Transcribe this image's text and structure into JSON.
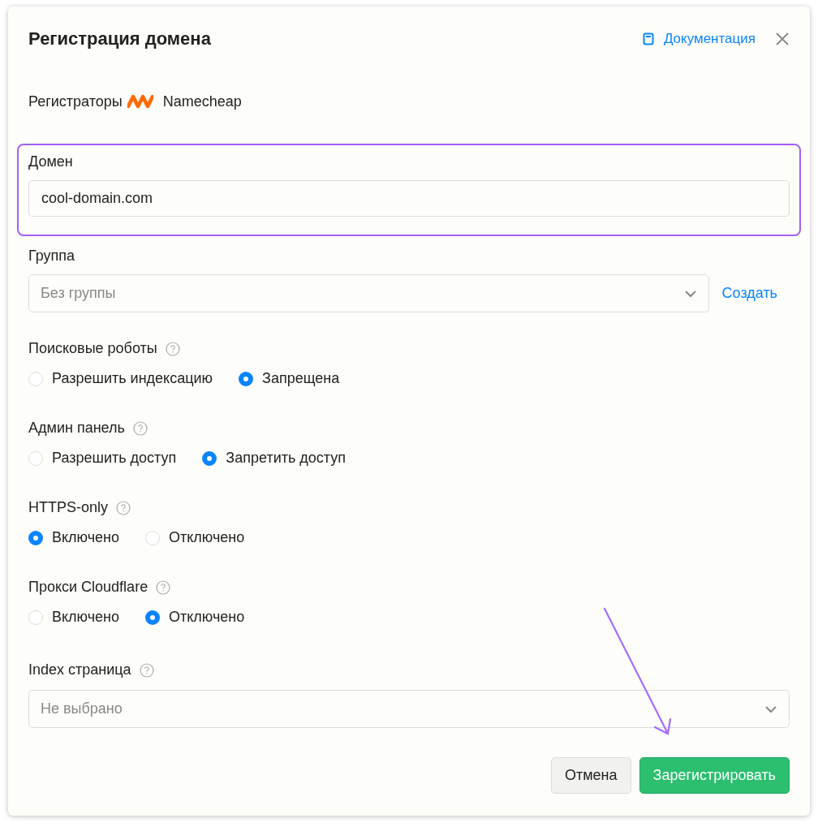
{
  "dialog": {
    "title": "Регистрация домена",
    "doc_link": "Документация"
  },
  "registrar": {
    "label": "Регистраторы",
    "name": "Namecheap"
  },
  "domain": {
    "label": "Домен",
    "value": "cool-domain.com",
    "highlighted": true
  },
  "group": {
    "label": "Группа",
    "placeholder": "Без группы",
    "create_link": "Создать"
  },
  "radio_groups": [
    {
      "label": "Поисковые роботы",
      "options": [
        {
          "label": "Разрешить индексацию",
          "selected": false
        },
        {
          "label": "Запрещена",
          "selected": true
        }
      ]
    },
    {
      "label": "Админ панель",
      "options": [
        {
          "label": "Разрешить доступ",
          "selected": false
        },
        {
          "label": "Запретить доступ",
          "selected": true
        }
      ]
    },
    {
      "label": "HTTPS-only",
      "options": [
        {
          "label": "Включено",
          "selected": true
        },
        {
          "label": "Отключено",
          "selected": false
        }
      ]
    },
    {
      "label": "Прокси Cloudflare",
      "options": [
        {
          "label": "Включено",
          "selected": false
        },
        {
          "label": "Отключено",
          "selected": true
        }
      ]
    }
  ],
  "index_page": {
    "label": "Index страница",
    "placeholder": "Не выбрано"
  },
  "buttons": {
    "cancel": "Отмена",
    "submit": "Зарегистрировать"
  },
  "arrow_annotation": true
}
